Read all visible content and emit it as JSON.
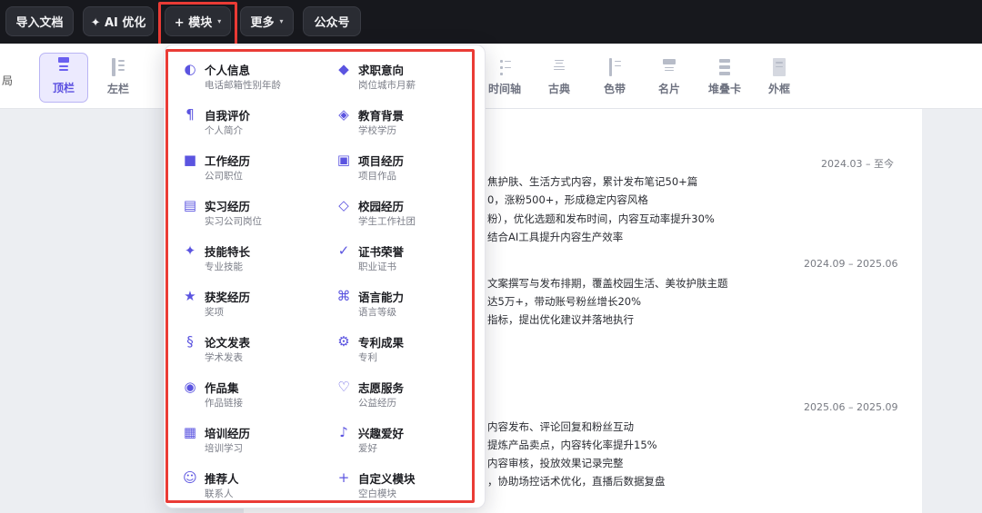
{
  "toolbar": {
    "import_label": "导入文档",
    "ai_label": "✦ AI 优化",
    "module_label": "+ 模块",
    "more_label": "更多",
    "official_label": "公众号"
  },
  "templates": {
    "left_cut_label": "局",
    "items": [
      {
        "label": "顶栏"
      },
      {
        "label": "左栏"
      },
      {
        "label": "时间轴"
      },
      {
        "label": "古典"
      },
      {
        "label": "色带"
      },
      {
        "label": "名片"
      },
      {
        "label": "堆叠卡"
      },
      {
        "label": "外框"
      }
    ]
  },
  "resume": {
    "dates": [
      "2024.03 – 至今",
      "2024.09 – 2025.06",
      "2025.06 – 2025.09"
    ],
    "lines": [
      "焦护肤、生活方式内容，累计发布笔记50+篇",
      "0，涨粉500+，形成稳定内容风格",
      "粉），优化选题和发布时间，内容互动率提升30%",
      "结合AI工具提升内容生产效率",
      "文案撰写与发布排期，覆盖校园生活、美妆护肤主题",
      "达5万+，带动账号粉丝增长20%",
      "指标，提出优化建议并落地执行",
      "内容发布、评论回复和粉丝互动",
      "提炼产品卖点，内容转化率提升15%",
      "内容审核，投放效果记录完整",
      "，协助场控话术优化，直播后数据复盘"
    ]
  },
  "modules": [
    {
      "title": "个人信息",
      "sub": "电话邮箱性别年龄",
      "icon": "◐"
    },
    {
      "title": "求职意向",
      "sub": "岗位城市月薪",
      "icon": "◆"
    },
    {
      "title": "自我评价",
      "sub": "个人简介",
      "icon": "¶"
    },
    {
      "title": "教育背景",
      "sub": "学校学历",
      "icon": "◈"
    },
    {
      "title": "工作经历",
      "sub": "公司职位",
      "icon": "■"
    },
    {
      "title": "项目经历",
      "sub": "项目作品",
      "icon": "▣"
    },
    {
      "title": "实习经历",
      "sub": "实习公司岗位",
      "icon": "▤"
    },
    {
      "title": "校园经历",
      "sub": "学生工作社团",
      "icon": "◇"
    },
    {
      "title": "技能特长",
      "sub": "专业技能",
      "icon": "✦"
    },
    {
      "title": "证书荣誉",
      "sub": "职业证书",
      "icon": "✓"
    },
    {
      "title": "获奖经历",
      "sub": "奖项",
      "icon": "★"
    },
    {
      "title": "语言能力",
      "sub": "语言等级",
      "icon": "⌘"
    },
    {
      "title": "论文发表",
      "sub": "学术发表",
      "icon": "§"
    },
    {
      "title": "专利成果",
      "sub": "专利",
      "icon": "⚙"
    },
    {
      "title": "作品集",
      "sub": "作品链接",
      "icon": "◉"
    },
    {
      "title": "志愿服务",
      "sub": "公益经历",
      "icon": "♡"
    },
    {
      "title": "培训经历",
      "sub": "培训学习",
      "icon": "▦"
    },
    {
      "title": "兴趣爱好",
      "sub": "爱好",
      "icon": "♪"
    },
    {
      "title": "推荐人",
      "sub": "联系人",
      "icon": "☺"
    },
    {
      "title": "自定义模块",
      "sub": "空白模块",
      "icon": "+"
    }
  ]
}
